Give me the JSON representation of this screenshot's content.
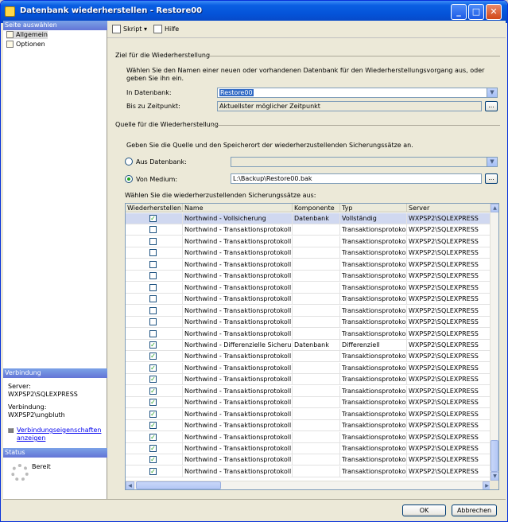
{
  "window": {
    "title": "Datenbank wiederherstellen - Restore00",
    "minimize": "_",
    "maximize": "□",
    "close": "✕"
  },
  "left": {
    "select_page_header": "Seite auswählen",
    "pages": [
      "Allgemein",
      "Optionen"
    ],
    "connection_header": "Verbindung",
    "server_label": "Server:",
    "server_value": "WXPSP2\\SQLEXPRESS",
    "connection_label": "Verbindung:",
    "connection_value": "WXPSP2\\ungbluth",
    "link_line1": "Verbindungseigenschaften",
    "link_line2": "anzeigen",
    "status_header": "Status",
    "status_value": "Bereit"
  },
  "toolbar": {
    "script": "Skript",
    "script_arrow": "▾",
    "help": "Hilfe"
  },
  "target": {
    "group": "Ziel für die Wiederherstellung",
    "description": "Wählen Sie den Namen einer neuen oder vorhandenen Datenbank für den Wiederherstellungsvorgang aus, oder geben Sie ihn ein.",
    "db_label": "In Datenbank:",
    "db_value": "Restore00",
    "time_label": "Bis zu Zeitpunkt:",
    "time_value": "Aktuellster möglicher Zeitpunkt",
    "browse": "..."
  },
  "source": {
    "group": "Quelle für die Wiederherstellung",
    "description": "Geben Sie die Quelle und den Speicherort der wiederherzustellenden Sicherungssätze an.",
    "from_db_label": "Aus Datenbank:",
    "from_db_value": "",
    "from_device_label": "Von Medium:",
    "from_device_value": "L:\\Backup\\Restore00.bak",
    "browse": "...",
    "sets_label": "Wählen Sie die wiederherzustellenden Sicherungssätze aus:"
  },
  "grid": {
    "columns": [
      "Wiederherstellen",
      "Name",
      "Komponente",
      "Typ",
      "Server"
    ],
    "rows": [
      {
        "checked": true,
        "name": "Northwind - Vollsicherung",
        "component": "Datenbank",
        "type": "Vollständig",
        "server": "WXPSP2\\SQLEXPRESS"
      },
      {
        "checked": false,
        "name": "Northwind - Transaktionsprotokoll",
        "component": "",
        "type": "Transaktionsprotokoll",
        "server": "WXPSP2\\SQLEXPRESS"
      },
      {
        "checked": false,
        "name": "Northwind - Transaktionsprotokoll",
        "component": "",
        "type": "Transaktionsprotokoll",
        "server": "WXPSP2\\SQLEXPRESS"
      },
      {
        "checked": false,
        "name": "Northwind - Transaktionsprotokoll",
        "component": "",
        "type": "Transaktionsprotokoll",
        "server": "WXPSP2\\SQLEXPRESS"
      },
      {
        "checked": false,
        "name": "Northwind - Transaktionsprotokoll",
        "component": "",
        "type": "Transaktionsprotokoll",
        "server": "WXPSP2\\SQLEXPRESS"
      },
      {
        "checked": false,
        "name": "Northwind - Transaktionsprotokoll",
        "component": "",
        "type": "Transaktionsprotokoll",
        "server": "WXPSP2\\SQLEXPRESS"
      },
      {
        "checked": false,
        "name": "Northwind - Transaktionsprotokoll",
        "component": "",
        "type": "Transaktionsprotokoll",
        "server": "WXPSP2\\SQLEXPRESS"
      },
      {
        "checked": false,
        "name": "Northwind - Transaktionsprotokoll",
        "component": "",
        "type": "Transaktionsprotokoll",
        "server": "WXPSP2\\SQLEXPRESS"
      },
      {
        "checked": false,
        "name": "Northwind - Transaktionsprotokoll",
        "component": "",
        "type": "Transaktionsprotokoll",
        "server": "WXPSP2\\SQLEXPRESS"
      },
      {
        "checked": false,
        "name": "Northwind - Transaktionsprotokoll",
        "component": "",
        "type": "Transaktionsprotokoll",
        "server": "WXPSP2\\SQLEXPRESS"
      },
      {
        "checked": false,
        "name": "Northwind - Transaktionsprotokoll",
        "component": "",
        "type": "Transaktionsprotokoll",
        "server": "WXPSP2\\SQLEXPRESS"
      },
      {
        "checked": true,
        "name": "Northwind - Differenzielle Sicherung",
        "component": "Datenbank",
        "type": "Differenziell",
        "server": "WXPSP2\\SQLEXPRESS"
      },
      {
        "checked": true,
        "name": "Northwind - Transaktionsprotokoll",
        "component": "",
        "type": "Transaktionsprotokoll",
        "server": "WXPSP2\\SQLEXPRESS"
      },
      {
        "checked": true,
        "name": "Northwind - Transaktionsprotokoll",
        "component": "",
        "type": "Transaktionsprotokoll",
        "server": "WXPSP2\\SQLEXPRESS"
      },
      {
        "checked": true,
        "name": "Northwind - Transaktionsprotokoll",
        "component": "",
        "type": "Transaktionsprotokoll",
        "server": "WXPSP2\\SQLEXPRESS"
      },
      {
        "checked": true,
        "name": "Northwind - Transaktionsprotokoll",
        "component": "",
        "type": "Transaktionsprotokoll",
        "server": "WXPSP2\\SQLEXPRESS"
      },
      {
        "checked": true,
        "name": "Northwind - Transaktionsprotokoll",
        "component": "",
        "type": "Transaktionsprotokoll",
        "server": "WXPSP2\\SQLEXPRESS"
      },
      {
        "checked": true,
        "name": "Northwind - Transaktionsprotokoll",
        "component": "",
        "type": "Transaktionsprotokoll",
        "server": "WXPSP2\\SQLEXPRESS"
      },
      {
        "checked": true,
        "name": "Northwind - Transaktionsprotokoll",
        "component": "",
        "type": "Transaktionsprotokoll",
        "server": "WXPSP2\\SQLEXPRESS"
      },
      {
        "checked": true,
        "name": "Northwind - Transaktionsprotokoll",
        "component": "",
        "type": "Transaktionsprotokoll",
        "server": "WXPSP2\\SQLEXPRESS"
      },
      {
        "checked": true,
        "name": "Northwind - Transaktionsprotokoll",
        "component": "",
        "type": "Transaktionsprotokoll",
        "server": "WXPSP2\\SQLEXPRESS"
      },
      {
        "checked": true,
        "name": "Northwind - Transaktionsprotokoll",
        "component": "",
        "type": "Transaktionsprotokoll",
        "server": "WXPSP2\\SQLEXPRESS"
      },
      {
        "checked": true,
        "name": "Northwind - Transaktionsprotokoll",
        "component": "",
        "type": "Transaktionsprotokoll",
        "server": "WXPSP2\\SQLEXPRESS"
      }
    ],
    "check_mark": "✓"
  },
  "footer": {
    "ok": "OK",
    "cancel": "Abbrechen"
  },
  "colors": {
    "titlebar": "#0a5fe3",
    "section_header": "#7ba2e7",
    "check": "#21a121",
    "selection": "#316ac5"
  }
}
